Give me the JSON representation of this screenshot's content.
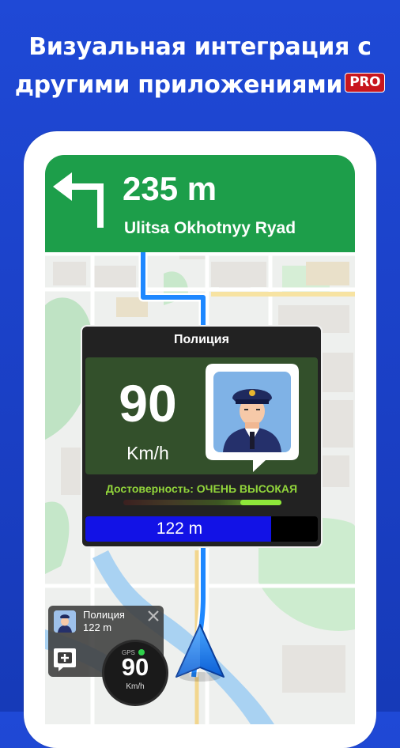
{
  "headline": {
    "line1": "Визуальная интеграция с",
    "line2": "другими приложениями",
    "badge": "PRO"
  },
  "navigation": {
    "distance": "235 m",
    "street": "Ulitsa Okhotnyy Ryad",
    "turn_icon": "turn-left-arrow-icon"
  },
  "alert": {
    "title": "Полиция",
    "speed_limit": "90",
    "speed_unit": "Km/h",
    "icon": "police-officer-icon",
    "confidence_text": "Достоверность: ОЧЕНЬ ВЫСОКАЯ",
    "distance_label": "122 m",
    "distance_progress": 0.8
  },
  "mini_alert": {
    "title": "Полиция",
    "distance": "122 m",
    "close_icon": "close-icon",
    "add_icon": "add-report-icon"
  },
  "speedometer": {
    "gps_label": "GPS",
    "speed": "90",
    "unit": "Km/h"
  },
  "colors": {
    "background": "#1f49d6",
    "nav_green": "#1d9e4a",
    "route_blue": "#1e88ff",
    "alert_panel": "#33502b",
    "confidence_green": "#92d63b",
    "distance_bar": "#1212e6",
    "pro_badge": "#c8161e"
  }
}
